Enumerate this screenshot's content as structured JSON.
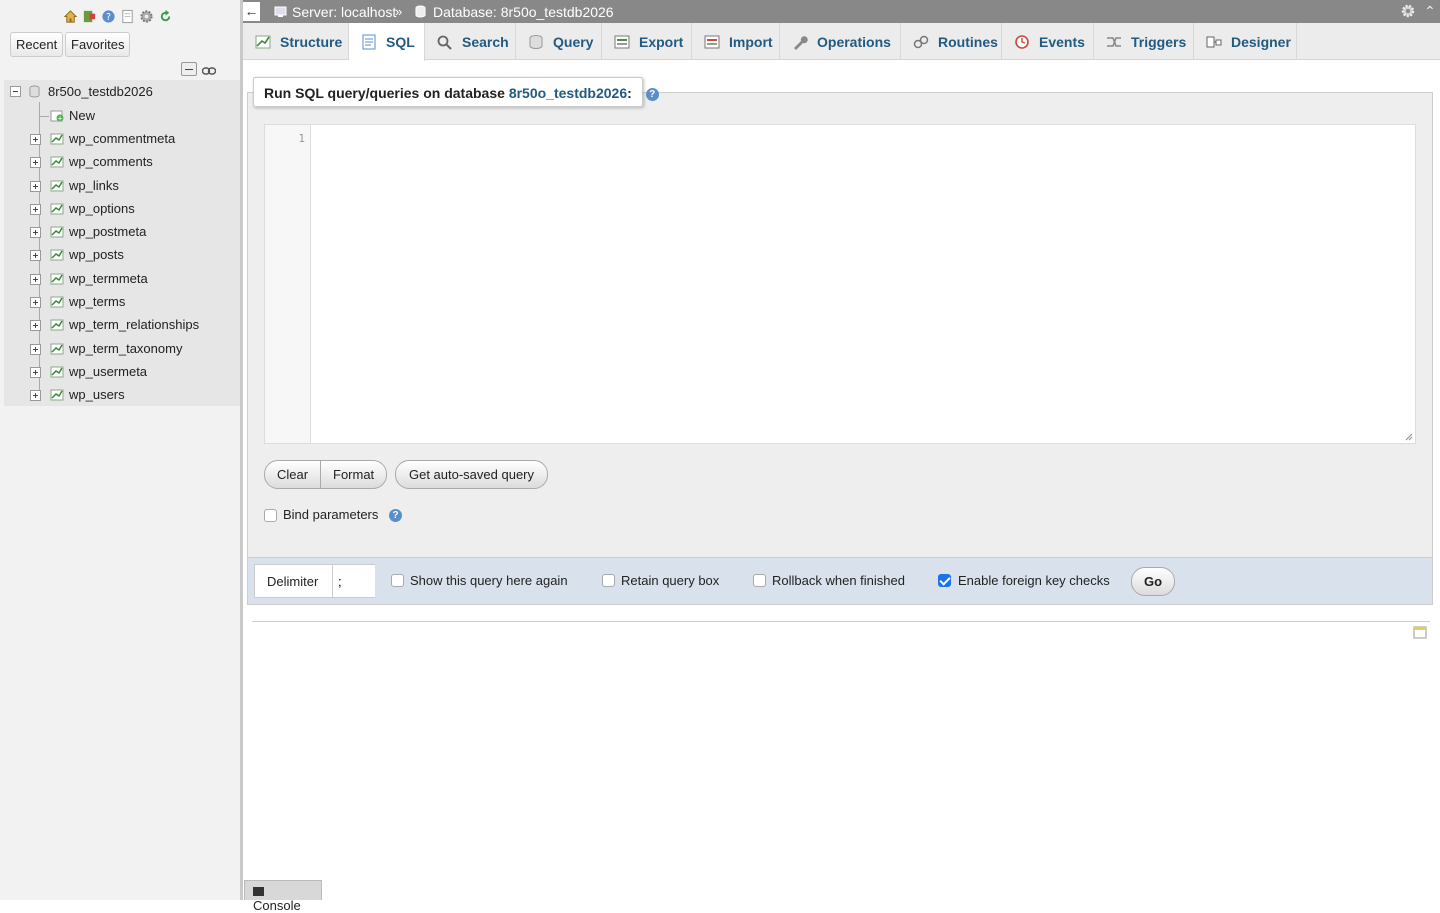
{
  "nav": {
    "recent_label": "Recent",
    "favorites_label": "Favorites",
    "icons": [
      "home-icon",
      "logout-icon",
      "help-icon",
      "docs-icon",
      "settings-icon",
      "reload-icon"
    ],
    "database": "8r50o_testdb2026",
    "new_label": "New",
    "tables": [
      "wp_commentmeta",
      "wp_comments",
      "wp_links",
      "wp_options",
      "wp_postmeta",
      "wp_posts",
      "wp_termmeta",
      "wp_terms",
      "wp_term_relationships",
      "wp_term_taxonomy",
      "wp_usermeta",
      "wp_users"
    ]
  },
  "breadcrumb": {
    "server": "Server: localhost",
    "separator": "»",
    "database": "Database: 8r50o_testdb2026"
  },
  "tabs": [
    {
      "label": "Structure",
      "icon": "structure-icon",
      "active": false
    },
    {
      "label": "SQL",
      "icon": "sql-icon",
      "active": true
    },
    {
      "label": "Search",
      "icon": "search-icon",
      "active": false
    },
    {
      "label": "Query",
      "icon": "query-icon",
      "active": false
    },
    {
      "label": "Export",
      "icon": "export-icon",
      "active": false
    },
    {
      "label": "Import",
      "icon": "import-icon",
      "active": false
    },
    {
      "label": "Operations",
      "icon": "wrench-icon",
      "active": false
    },
    {
      "label": "Routines",
      "icon": "routines-icon",
      "active": false
    },
    {
      "label": "Events",
      "icon": "clock-icon",
      "active": false
    },
    {
      "label": "Triggers",
      "icon": "triggers-icon",
      "active": false
    },
    {
      "label": "Designer",
      "icon": "designer-icon",
      "active": false
    }
  ],
  "sql": {
    "legend_prefix": "Run SQL query/queries on database",
    "legend_db": "8r50o_testdb2026",
    "legend_suffix": ":",
    "line_number": "1",
    "query_text": "",
    "clear_label": "Clear",
    "format_label": "Format",
    "autosave_label": "Get auto-saved query",
    "bind_params_label": "Bind parameters",
    "bind_params_checked": false
  },
  "options": {
    "delimiter_label": "Delimiter",
    "delimiter_value": ";",
    "show_query_label": "Show this query here again",
    "show_query_checked": false,
    "retain_label": "Retain query box",
    "retain_checked": false,
    "rollback_label": "Rollback when finished",
    "rollback_checked": false,
    "fk_label": "Enable foreign key checks",
    "fk_checked": true,
    "go_label": "Go"
  },
  "console": {
    "label": "Console"
  },
  "colors": {
    "link": "#235a81",
    "topbar": "#888888",
    "options_bg": "#d9e2ec",
    "checkbox": "#1a73e8"
  }
}
